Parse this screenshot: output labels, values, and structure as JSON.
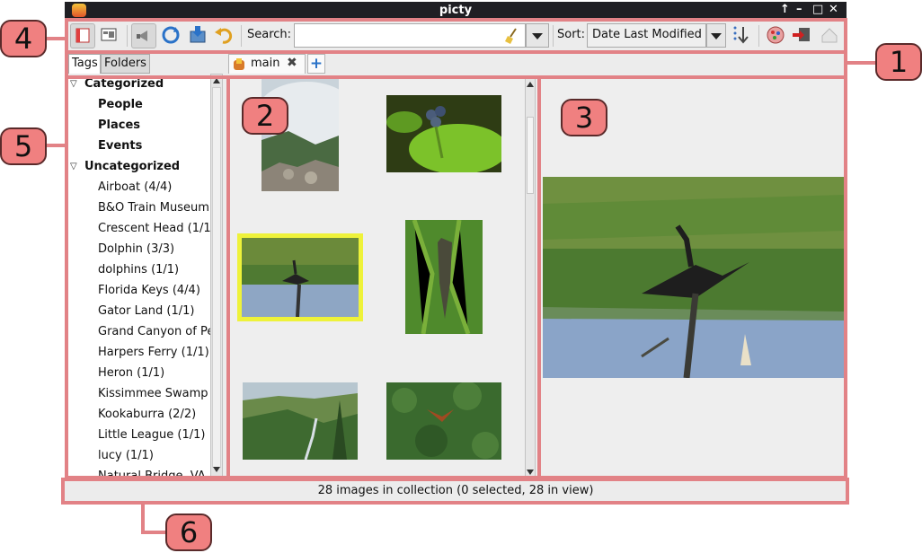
{
  "window": {
    "title": "picty"
  },
  "window_controls": [
    "↑",
    "–",
    "□",
    "✕"
  ],
  "toolbar": {
    "search_label": "Search:",
    "search_value": "",
    "sort_label": "Sort:",
    "sort_value": "Date Last Modified"
  },
  "collection_tabs": [
    {
      "label": "main",
      "close": "✖"
    }
  ],
  "add_tab_glyph": "+",
  "sidebar": {
    "tabs": [
      "Tags",
      "Folders"
    ],
    "active_tab": "Tags",
    "tree": [
      {
        "label": "Categorized",
        "bold": true,
        "level": 0,
        "expander": "▽"
      },
      {
        "label": "People",
        "bold": true,
        "level": 1
      },
      {
        "label": "Places",
        "bold": true,
        "level": 1
      },
      {
        "label": "Events",
        "bold": true,
        "level": 1
      },
      {
        "label": "Uncategorized",
        "bold": true,
        "level": 0,
        "expander": "▽"
      },
      {
        "label": "Airboat (4/4)",
        "level": 1
      },
      {
        "label": "B&O Train Museum",
        "level": 1
      },
      {
        "label": "Crescent Head (1/1",
        "level": 1
      },
      {
        "label": "Dolphin (3/3)",
        "level": 1
      },
      {
        "label": "dolphins (1/1)",
        "level": 1
      },
      {
        "label": "Florida Keys (4/4)",
        "level": 1
      },
      {
        "label": "Gator Land (1/1)",
        "level": 1
      },
      {
        "label": "Grand Canyon of Pe",
        "level": 1
      },
      {
        "label": "Harpers Ferry (1/1)",
        "level": 1
      },
      {
        "label": "Heron (1/1)",
        "level": 1
      },
      {
        "label": "Kissimmee Swamp",
        "level": 1
      },
      {
        "label": "Kookaburra (2/2)",
        "level": 1
      },
      {
        "label": "Little League (1/1)",
        "level": 1
      },
      {
        "label": "lucy (1/1)",
        "level": 1
      },
      {
        "label": "Natural Bridge, VA",
        "level": 1
      }
    ]
  },
  "thumbnails": [
    {
      "subject": "misty mountain rocks",
      "selected": false
    },
    {
      "subject": "berries on green leaf",
      "selected": false
    },
    {
      "subject": "anhinga bird drying wings",
      "selected": true
    },
    {
      "subject": "alligator in grass",
      "selected": false
    },
    {
      "subject": "green river valley",
      "selected": false
    },
    {
      "subject": "hawk over forest",
      "selected": false
    }
  ],
  "selection_color": "#eef23a",
  "status_bar": {
    "text": "28 images in collection (0 selected, 28 in view)"
  },
  "callouts": [
    "1",
    "2",
    "3",
    "4",
    "5",
    "6"
  ],
  "highlight_color": "#e28286"
}
